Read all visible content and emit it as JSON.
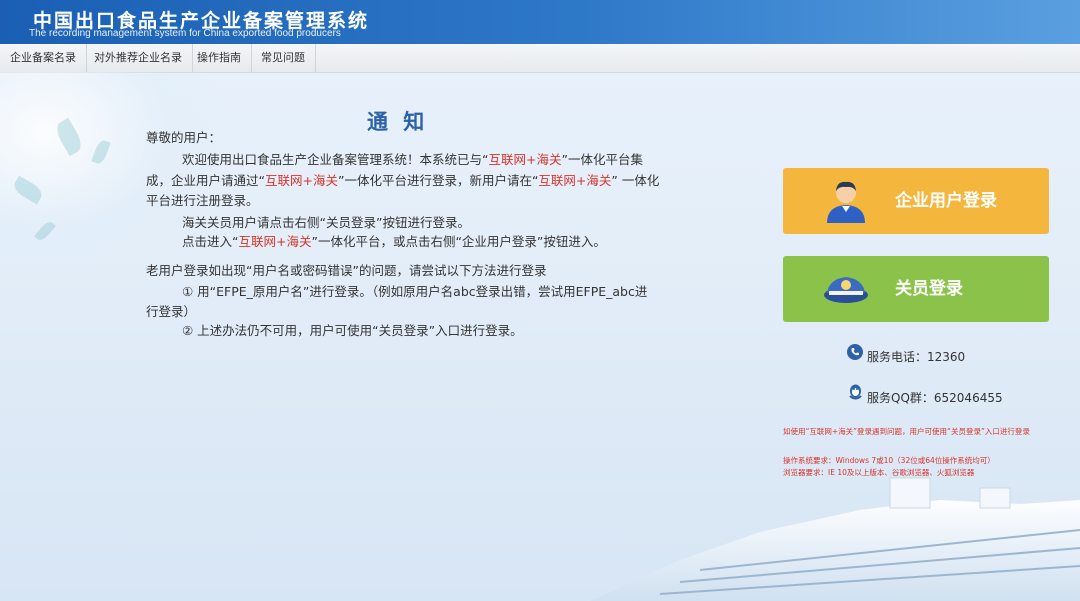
{
  "header": {
    "title_cn": "中国出口食品生产企业备案管理系统",
    "title_en": "The recording management system for China exported food producers"
  },
  "nav": {
    "items": [
      "企业备案名录",
      "对外推荐企业名录",
      "操作指南",
      "常见问题"
    ]
  },
  "notice": {
    "title": "通 知",
    "greeting": "尊敬的用户：",
    "p1_a": "欢迎使用出口食品生产企业备案管理系统！本系统已与“",
    "p1_red1": "互联网+海关",
    "p1_b": "”一体化平台集",
    "p2_a": "成，企业用户请通过“",
    "p2_red2": "互联网+海关",
    "p2_b": "”一体化平台进行登录，新用户请在“",
    "p2_red3": "互联网+海关",
    "p2_c": "” 一体化",
    "p3": "平台进行注册登录。",
    "p4": "海关关员用户请点击右侧“关员登录”按钮进行登录。",
    "p5_a": "点击进入“",
    "p5_red": "互联网+海关",
    "p5_b": "”一体化平台，或点击右侧“企业用户登录”按钮进入。",
    "p6": "老用户登录如出现“用户名或密码错误”的问题，请尝试以下方法进行登录",
    "p7": "① 用“EFPE_原用户名”进行登录。（例如原用户名abc登录出错，尝试用EFPE_abc进",
    "p8": "行登录）",
    "p9": "② 上述办法仍不可用，用户可使用“关员登录”入口进行登录。"
  },
  "buttons": {
    "enterprise_label": "企业用户登录",
    "customs_label": "关员登录"
  },
  "service": {
    "phone": "服务电话：12360",
    "qq": "服务QQ群：652046455"
  },
  "notes": {
    "note1": "如使用“互联网+海关”登录遇到问题，用户可使用“关员登录”入口进行登录",
    "os_req": "操作系统要求：Windows 7或10（32位或64位操作系统均可）",
    "browser_req": "浏览器要求：IE 10及以上版本、谷歌浏览器、火狐浏览器"
  },
  "colors": {
    "header_blue": "#1a5fb4",
    "enterprise_button": "#f4b63c",
    "customs_button": "#8bc34a",
    "accent_red": "#d9342b",
    "title_blue": "#2d62a8"
  },
  "icons": {
    "enterprise": "user-icon",
    "customs": "officer-cap-icon",
    "phone": "phone-icon",
    "qq": "qq-icon"
  }
}
